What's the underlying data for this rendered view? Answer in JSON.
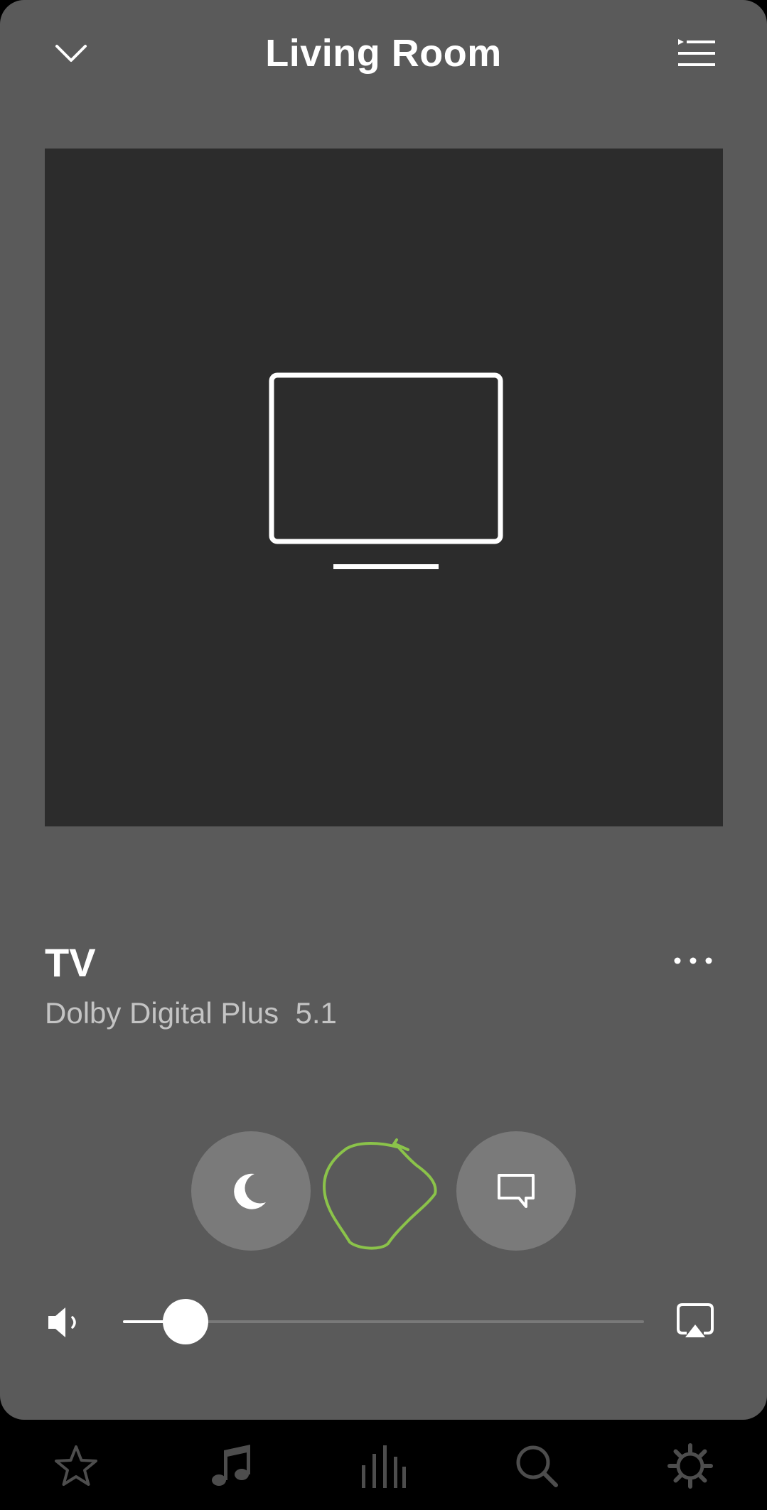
{
  "header": {
    "room_title": "Living Room",
    "collapse_icon": "chevron-down-icon",
    "queue_icon": "queue-list-icon"
  },
  "now_playing": {
    "artwork_icon": "tv-icon",
    "title": "TV",
    "subtitle": "Dolby Digital Plus  5.1",
    "more_icon": "more-horizontal-icon"
  },
  "controls": {
    "night_sound_icon": "moon-icon",
    "speech_enhancement_icon": "speech-bubble-icon",
    "annotation_color": "#8bc34a"
  },
  "volume": {
    "level": 0.12,
    "speaker_icon": "speaker-low-icon",
    "output_icon": "airplay-icon"
  },
  "bottom_nav": {
    "items": [
      "star-icon",
      "music-note-icon",
      "rooms-bars-icon",
      "search-icon",
      "gear-icon"
    ]
  },
  "colors": {
    "panel": "#5a5a5a",
    "artwork_bg": "#2c2c2c",
    "nav_bg": "#000000",
    "nav_icon": "#4d4d4d",
    "subtitle": "#c4c4c4"
  }
}
